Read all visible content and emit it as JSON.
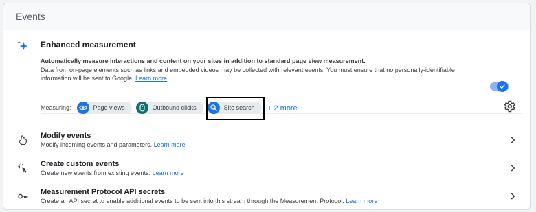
{
  "header": {
    "title": "Events"
  },
  "enhanced": {
    "title": "Enhanced measurement",
    "description_bold": "Automatically measure interactions and content on your sites in addition to standard page view measurement.",
    "description": "Data from on-page elements such as links and embedded videos may be collected with relevant events. You must ensure that no personally-identifiable information will be sent to Google.",
    "learn_more": "Learn more",
    "toggle_on": true,
    "measuring_label": "Measuring:",
    "chips": [
      {
        "label": "Page views",
        "icon": "eye-icon"
      },
      {
        "label": "Outbound clicks",
        "icon": "mouse-icon"
      },
      {
        "label": "Site search",
        "icon": "search-icon"
      }
    ],
    "more_label": "+ 2 more"
  },
  "rows": [
    {
      "title": "Modify events",
      "description": "Modify incoming events and parameters.",
      "link": "Learn more",
      "icon": "touch-icon"
    },
    {
      "title": "Create custom events",
      "description": "Create new events from existing events.",
      "link": "Learn more",
      "icon": "click-icon"
    },
    {
      "title": "Measurement Protocol API secrets",
      "description": "Create an API secret to enable additional events to be sent into this stream through the Measurement Protocol.",
      "link": "Learn more",
      "icon": "key-icon"
    }
  ],
  "colors": {
    "accent": "#1a73e8",
    "teal": "#12706b",
    "chip_bg": "#e8eaed",
    "border": "#dadce0"
  }
}
